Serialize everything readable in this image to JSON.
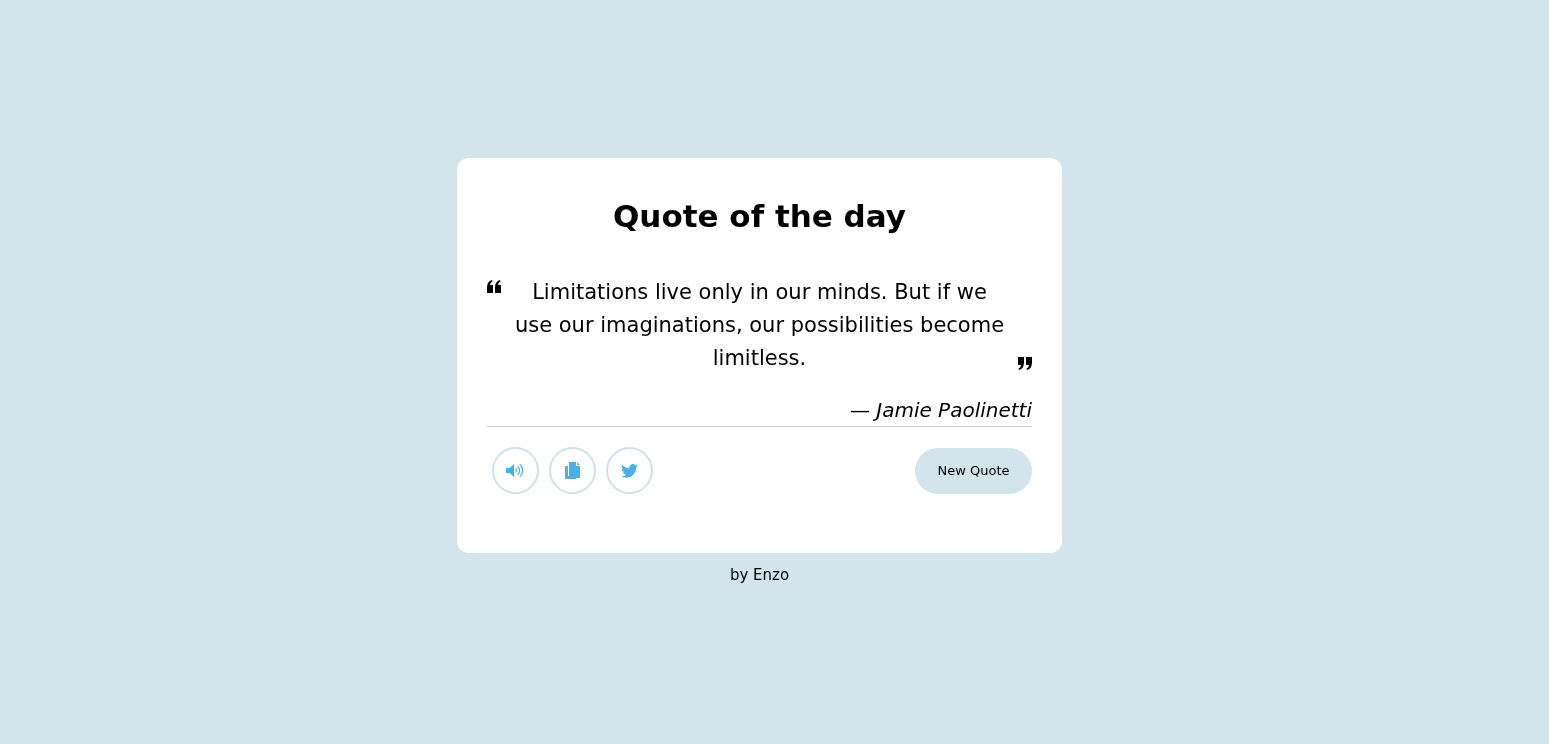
{
  "card": {
    "title": "Quote of the day",
    "quote": "Limitations live only in our minds. But if we use our imaginations, our possibilities become limitless.",
    "author": "— *Jamie Paolinetti*",
    "new_quote_button": "New Quote"
  },
  "footer": "by Enzo"
}
